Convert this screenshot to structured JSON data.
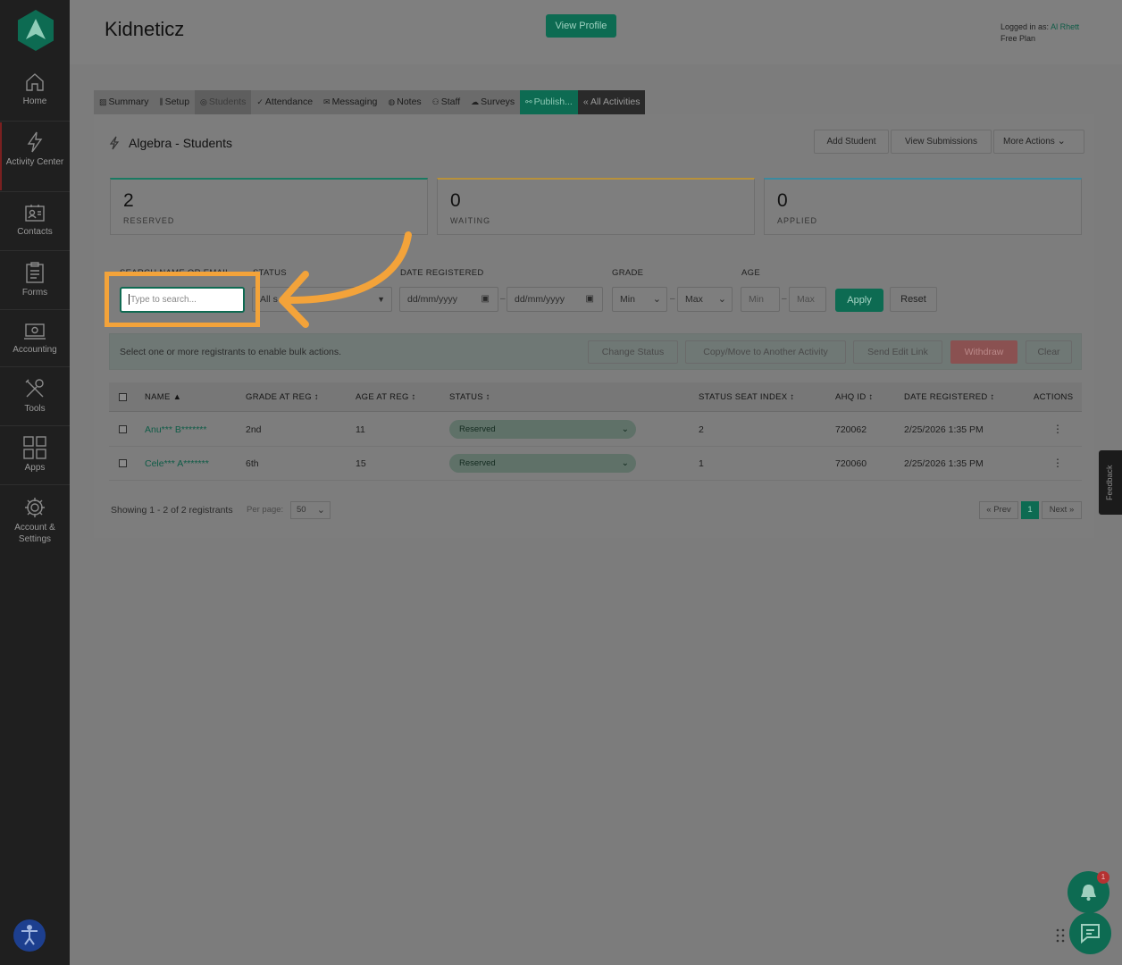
{
  "sidebar": {
    "items": [
      {
        "label": "Home",
        "icon": "home-icon"
      },
      {
        "label": "Activity Center",
        "icon": "bolt-icon"
      },
      {
        "label": "Contacts",
        "icon": "contacts-icon"
      },
      {
        "label": "Forms",
        "icon": "forms-icon"
      },
      {
        "label": "Accounting",
        "icon": "accounting-icon"
      },
      {
        "label": "Tools",
        "icon": "tools-icon"
      },
      {
        "label": "Apps",
        "icon": "apps-icon"
      },
      {
        "label": "Account & Settings",
        "icon": "gear-icon"
      }
    ]
  },
  "header": {
    "brand": "Kidneticz",
    "view_profile": "View Profile",
    "logged_in_prefix": "Logged in as:",
    "user": "Al Rhett",
    "plan": "Free Plan"
  },
  "tabs": [
    {
      "label": "Summary",
      "icon": "summary-icon"
    },
    {
      "label": "Setup",
      "icon": "setup-icon"
    },
    {
      "label": "Students",
      "icon": "students-icon"
    },
    {
      "label": "Attendance",
      "icon": "check-icon"
    },
    {
      "label": "Messaging",
      "icon": "mail-icon"
    },
    {
      "label": "Notes",
      "icon": "notes-icon"
    },
    {
      "label": "Staff",
      "icon": "staff-icon"
    },
    {
      "label": "Surveys",
      "icon": "cloud-icon"
    },
    {
      "label": "Publish...",
      "icon": "link-icon"
    },
    {
      "label": "« All Activities",
      "icon": ""
    }
  ],
  "page": {
    "title": "Algebra - Students",
    "add_student": "Add Student",
    "view_submissions": "View Submissions",
    "more_actions": "More Actions"
  },
  "stats": [
    {
      "value": "2",
      "label": "RESERVED",
      "color": "#1a7a62"
    },
    {
      "value": "0",
      "label": "WAITING",
      "color": "#b8913a"
    },
    {
      "value": "0",
      "label": "APPLIED",
      "color": "#3a8aa0"
    }
  ],
  "filters": {
    "search_label": "SEARCH NAME OR EMAIL",
    "search_placeholder": "Type to search...",
    "status_label": "STATUS",
    "status_value": "All s",
    "date_label": "DATE REGISTERED",
    "date_from": "dd/mm/yyyy",
    "date_to": "dd/mm/yyyy",
    "grade_label": "GRADE",
    "grade_min": "Min",
    "grade_max": "Max",
    "age_label": "AGE",
    "age_min": "Min",
    "age_max": "Max",
    "apply": "Apply",
    "reset": "Reset",
    "dash": "–"
  },
  "bulk": {
    "text": "Select one or more registrants to enable bulk actions.",
    "change_status": "Change Status",
    "copy_move": "Copy/Move to Another Activity",
    "send_edit_link": "Send Edit Link",
    "withdraw": "Withdraw",
    "clear": "Clear"
  },
  "table": {
    "headers": [
      "NAME ▲",
      "GRADE AT REG ↕",
      "AGE AT REG ↕",
      "STATUS ↕",
      "STATUS SEAT INDEX ↕",
      "AHQ ID ↕",
      "DATE REGISTERED ↕",
      "ACTIONS"
    ],
    "rows": [
      {
        "name": "Anu*** B*******",
        "grade": "2nd",
        "age": "11",
        "status": "Reserved",
        "seat": "2",
        "ahq": "720062",
        "date": "2/25/2026 1:35 PM",
        "actions": "⋮"
      },
      {
        "name": "Cele*** A*******",
        "grade": "6th",
        "age": "15",
        "status": "Reserved",
        "seat": "1",
        "ahq": "720060",
        "date": "2/25/2026 1:35 PM",
        "actions": "⋮"
      }
    ]
  },
  "footer": {
    "showing": "Showing 1 - 2 of 2 registrants",
    "per_page_label": "Per page:",
    "per_page_value": "50",
    "prev": "« Prev",
    "current_page": "1",
    "next": "Next »"
  },
  "widgets": {
    "feedback": "Feedback",
    "notification_count": "1"
  },
  "colors": {
    "accent": "#0d6b52",
    "highlight": "#f3a33a"
  }
}
